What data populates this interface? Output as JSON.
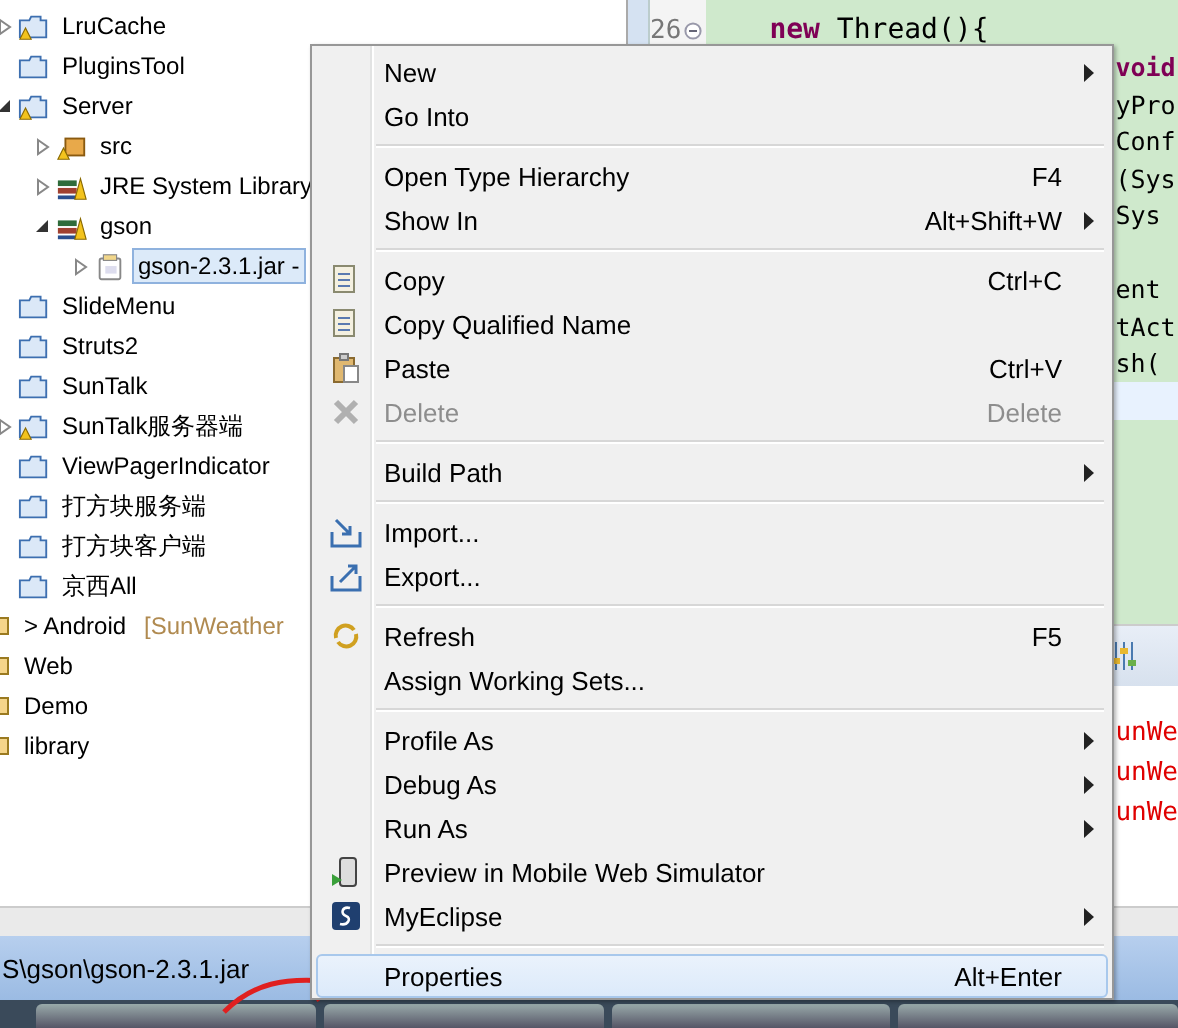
{
  "tree": {
    "group_items": [
      {
        "label": "LruCache",
        "kind": "project-warning",
        "expanded": false,
        "selected": false
      },
      {
        "label": "PluginsTool",
        "kind": "project",
        "selected": false
      },
      {
        "label": "Server",
        "kind": "project-warning",
        "expanded": true,
        "selected": false,
        "children": [
          {
            "label": "src",
            "kind": "package-folder",
            "expanded": false,
            "selected": false
          },
          {
            "label": "JRE System Library",
            "kind": "library",
            "expanded": false,
            "selected": false
          },
          {
            "label": "gson",
            "kind": "library",
            "expanded": true,
            "selected": false,
            "children": [
              {
                "label": "gson-2.3.1.jar -",
                "kind": "jar",
                "expanded": false,
                "selected": true
              }
            ]
          }
        ]
      },
      {
        "label": "SlideMenu",
        "kind": "project",
        "selected": false
      },
      {
        "label": "Struts2",
        "kind": "project",
        "selected": false
      },
      {
        "label": "SunTalk",
        "kind": "project",
        "selected": false
      },
      {
        "label": "SunTalk服务器端",
        "kind": "project-warning",
        "expanded": false,
        "selected": false
      },
      {
        "label": "ViewPagerIndicator",
        "kind": "project",
        "selected": false
      },
      {
        "label": "打方块服务端",
        "kind": "project",
        "selected": false
      },
      {
        "label": "打方块客户端",
        "kind": "project",
        "selected": false
      },
      {
        "label": "京西All",
        "kind": "project",
        "selected": false
      }
    ],
    "items": [
      {
        "label": "> Android",
        "decoration": "[SunWeather",
        "selected": false
      },
      {
        "label": "Web",
        "selected": false
      },
      {
        "label": "Demo",
        "selected": false
      },
      {
        "label": "library",
        "selected": false
      }
    ]
  },
  "editor": {
    "line_numbers": [
      "26"
    ],
    "rows": [
      {
        "kind": "line",
        "text": "**new** Thread(){",
        "current": false
      },
      {
        "kind": "clipped",
        "text": "**void**",
        "current": false
      },
      {
        "kind": "clipped",
        "text": "yPro",
        "current": false
      },
      {
        "kind": "clipped",
        "text": "Conf",
        "current": false
      },
      {
        "kind": "clipped",
        "text": "(Sys",
        "current": false
      },
      {
        "kind": "clipped",
        "text": "Sys",
        "current": false
      },
      {
        "kind": "clipped",
        "current": false
      },
      {
        "kind": "clipped",
        "text": "ent",
        "current": false
      },
      {
        "kind": "clipped",
        "text": "tAct",
        "current": false
      },
      {
        "kind": "clipped",
        "text": "sh(",
        "current": false
      },
      {
        "kind": "clipped",
        "current": true
      }
    ]
  },
  "console": {
    "lines": [
      "unWe",
      "unWe",
      "unWe"
    ]
  },
  "status_bar": {
    "text": "S\\gson\\gson-2.3.1.jar"
  },
  "context_menu": {
    "items": [
      {
        "kind": "item",
        "label": "New",
        "submenu": true,
        "disabled": false,
        "selected": false
      },
      {
        "kind": "item",
        "label": "Go Into",
        "submenu": false,
        "disabled": false,
        "selected": false
      },
      {
        "kind": "separator"
      },
      {
        "kind": "item",
        "label": "Open Type Hierarchy",
        "shortcut": "F4",
        "submenu": false,
        "disabled": false,
        "selected": false
      },
      {
        "kind": "item",
        "label": "Show In",
        "shortcut": "Alt+Shift+W",
        "submenu": true,
        "disabled": false,
        "selected": false
      },
      {
        "kind": "separator"
      },
      {
        "kind": "item",
        "label": "Copy",
        "shortcut": "Ctrl+C",
        "submenu": false,
        "disabled": false,
        "selected": false
      },
      {
        "kind": "item",
        "label": "Copy Qualified Name",
        "submenu": false,
        "disabled": false,
        "selected": false
      },
      {
        "kind": "item",
        "label": "Paste",
        "shortcut": "Ctrl+V",
        "submenu": false,
        "disabled": false,
        "selected": false
      },
      {
        "kind": "item",
        "label": "Delete",
        "shortcut": "Delete",
        "submenu": false,
        "disabled": true,
        "selected": false
      },
      {
        "kind": "separator"
      },
      {
        "kind": "item",
        "label": "Build Path",
        "submenu": true,
        "disabled": false,
        "selected": false
      },
      {
        "kind": "separator"
      },
      {
        "kind": "item",
        "label": "Import...",
        "submenu": false,
        "disabled": false,
        "selected": false
      },
      {
        "kind": "item",
        "label": "Export...",
        "submenu": false,
        "disabled": false,
        "selected": false
      },
      {
        "kind": "separator"
      },
      {
        "kind": "item",
        "label": "Refresh",
        "shortcut": "F5",
        "submenu": false,
        "disabled": false,
        "selected": false
      },
      {
        "kind": "item",
        "label": "Assign Working Sets...",
        "submenu": false,
        "disabled": false,
        "selected": false
      },
      {
        "kind": "separator"
      },
      {
        "kind": "item",
        "label": "Profile As",
        "submenu": true,
        "disabled": false,
        "selected": false
      },
      {
        "kind": "item",
        "label": "Debug As",
        "submenu": true,
        "disabled": false,
        "selected": false
      },
      {
        "kind": "item",
        "label": "Run As",
        "submenu": true,
        "disabled": false,
        "selected": false
      },
      {
        "kind": "item",
        "label": "Preview in Mobile Web Simulator",
        "submenu": false,
        "disabled": false,
        "selected": false
      },
      {
        "kind": "item",
        "label": "MyEclipse",
        "submenu": true,
        "disabled": false,
        "selected": false
      },
      {
        "kind": "separator"
      },
      {
        "kind": "item",
        "label": "Properties",
        "shortcut": "Alt+Enter",
        "submenu": false,
        "disabled": false,
        "selected": true
      }
    ]
  }
}
